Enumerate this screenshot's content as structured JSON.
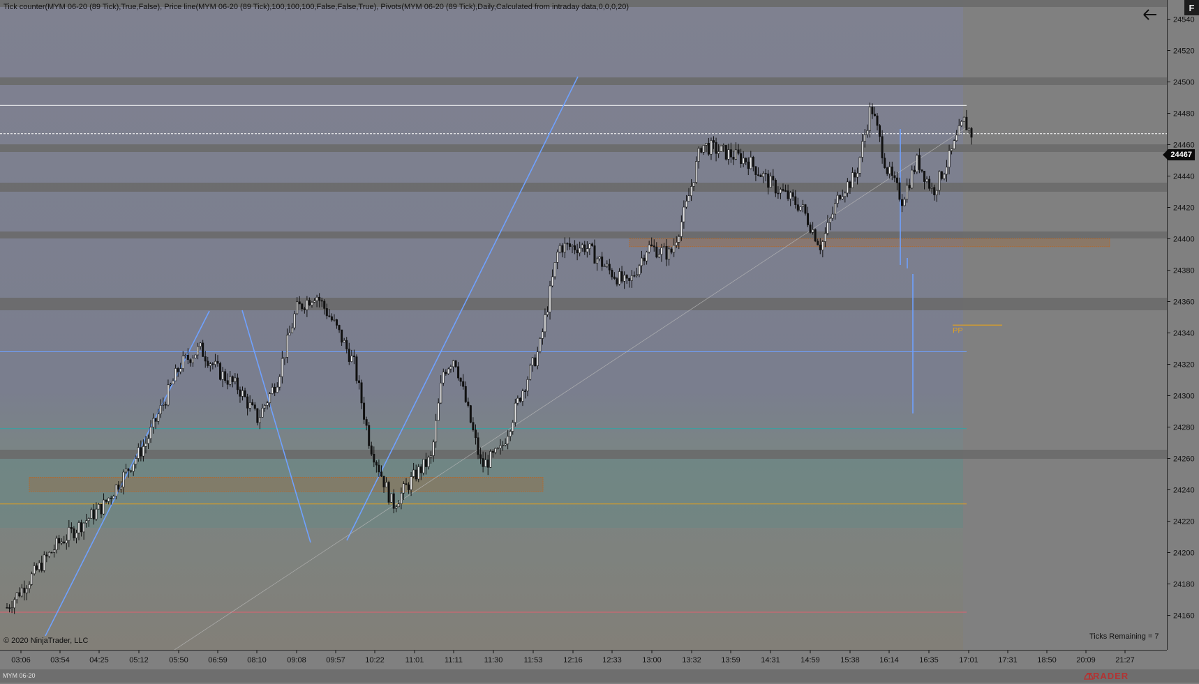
{
  "indicator_label": "Tick counter(MYM 06-20 (89 Tick),True,False), Price line(MYM 06-20 (89 Tick),100,100,100,False,False,True), Pivots(MYM 06-20 (89 Tick),Daily,Calculated from intraday data,0,0,0,20)",
  "copyright": "© 2020 NinjaTrader, LLC",
  "ticks_remaining": "Ticks Remaining = 7",
  "current_price": "24467",
  "pivot_label": "PP",
  "instrument": "MYM 06-20",
  "logo_text": "TRADER",
  "menu_button_label": "F",
  "colors": {
    "background": "#808080",
    "candle": "#111111",
    "trendline": "#6fa1ff",
    "pivot_orange": "#e0a020",
    "zone_border": "#b06a30",
    "teal_line": "#2fa5a5",
    "red_line": "#e06070",
    "price_line": "#ffffff"
  },
  "price_axis": {
    "ticks": [
      "24540",
      "24520",
      "24500",
      "24480",
      "24460",
      "24440",
      "24420",
      "24400",
      "24380",
      "24360",
      "24340",
      "24320",
      "24300",
      "24280",
      "24260",
      "24240",
      "24220",
      "24200",
      "24180",
      "24160"
    ]
  },
  "time_axis": {
    "labels": [
      "03:06",
      "03:54",
      "04:25",
      "05:12",
      "05:50",
      "06:59",
      "08:10",
      "09:08",
      "09:57",
      "10:22",
      "11:01",
      "11:11",
      "11:30",
      "11:53",
      "12:16",
      "12:33",
      "13:00",
      "13:32",
      "13:59",
      "14:31",
      "14:59",
      "15:38",
      "16:14",
      "16:35",
      "17:01",
      "17:31",
      "18:50",
      "20:09",
      "21:27"
    ]
  },
  "chart_data": {
    "type": "candlestick",
    "instrument": "MYM 06-20 (89 Tick)",
    "ylim": [
      24155,
      24555
    ],
    "x_labels": [
      "03:06",
      "03:54",
      "04:25",
      "05:12",
      "05:50",
      "06:59",
      "08:10",
      "09:08",
      "09:57",
      "10:22",
      "11:01",
      "11:11",
      "11:30",
      "11:53",
      "12:16",
      "12:33",
      "13:00",
      "13:32",
      "13:59",
      "14:31",
      "14:59",
      "15:38",
      "16:14",
      "16:35",
      "17:01",
      "17:31",
      "18:50",
      "20:09",
      "21:27"
    ],
    "last_price": 24467,
    "close_path": [
      [
        0,
        24165
      ],
      [
        1.3,
        24205
      ],
      [
        2.5,
        24230
      ],
      [
        3.6,
        24270
      ],
      [
        4.5,
        24320
      ],
      [
        5.0,
        24330
      ],
      [
        5.5,
        24315
      ],
      [
        6.0,
        24305
      ],
      [
        6.5,
        24285
      ],
      [
        7.0,
        24310
      ],
      [
        7.5,
        24355
      ],
      [
        8.0,
        24365
      ],
      [
        8.5,
        24345
      ],
      [
        9.0,
        24320
      ],
      [
        9.4,
        24270
      ],
      [
        10.0,
        24230
      ],
      [
        10.6,
        24250
      ],
      [
        11.0,
        24260
      ],
      [
        11.3,
        24315
      ],
      [
        11.6,
        24325
      ],
      [
        12.0,
        24285
      ],
      [
        12.3,
        24255
      ],
      [
        12.8,
        24265
      ],
      [
        13.3,
        24300
      ],
      [
        13.8,
        24330
      ],
      [
        14.3,
        24395
      ],
      [
        15.0,
        24395
      ],
      [
        15.6,
        24380
      ],
      [
        16.1,
        24370
      ],
      [
        16.6,
        24395
      ],
      [
        17.2,
        24390
      ],
      [
        17.6,
        24420
      ],
      [
        18.0,
        24460
      ],
      [
        18.6,
        24455
      ],
      [
        19.2,
        24450
      ],
      [
        19.8,
        24435
      ],
      [
        20.6,
        24420
      ],
      [
        21.1,
        24395
      ],
      [
        21.6,
        24430
      ],
      [
        22.0,
        24440
      ],
      [
        22.4,
        24485
      ],
      [
        22.8,
        24445
      ],
      [
        23.2,
        24425
      ],
      [
        23.6,
        24450
      ],
      [
        24.0,
        24430
      ],
      [
        24.4,
        24450
      ],
      [
        24.8,
        24475
      ],
      [
        25.0,
        24467
      ]
    ],
    "horizontal_levels": [
      {
        "price": 24485,
        "color": "white"
      },
      {
        "price": 24467,
        "color": "white",
        "style": "dashed"
      },
      {
        "price": 24328,
        "color": "blue"
      },
      {
        "price": 24279,
        "color": "teal"
      },
      {
        "price": 24231,
        "color": "orange"
      },
      {
        "price": 24162,
        "color": "red"
      },
      {
        "price": 24345,
        "color": "orange",
        "label": "PP"
      }
    ],
    "zones": [
      {
        "from": 24239,
        "to": 24248
      },
      {
        "from": 24395,
        "to": 24400
      }
    ]
  }
}
